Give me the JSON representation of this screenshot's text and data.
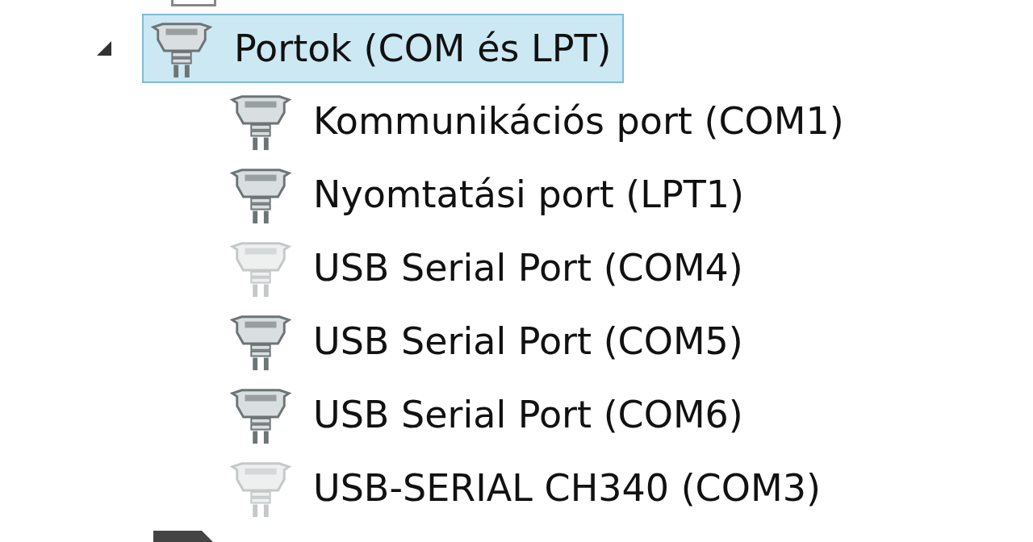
{
  "tree": [
    {
      "label": "Portok (COM és LPT)",
      "expanded": true,
      "selected": true,
      "children": [
        {
          "label": "Kommunikációs port (COM1)",
          "faded": false
        },
        {
          "label": "Nyomtatási port (LPT1)",
          "faded": false
        },
        {
          "label": "USB Serial Port (COM4)",
          "faded": true
        },
        {
          "label": "USB Serial Port (COM5)",
          "faded": false
        },
        {
          "label": "USB Serial Port (COM6)",
          "faded": false
        },
        {
          "label": "USB-SERIAL CH340 (COM3)",
          "faded": true
        }
      ]
    }
  ]
}
